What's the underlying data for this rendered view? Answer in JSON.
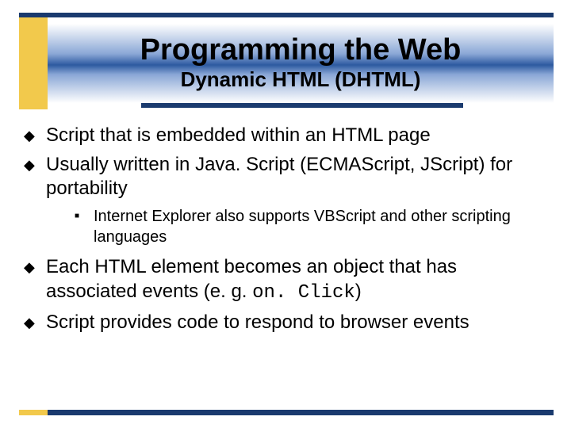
{
  "header": {
    "title": "Programming the Web",
    "subtitle": "Dynamic HTML (DHTML)"
  },
  "bullets": {
    "b1": "Script that is embedded within an HTML page",
    "b2": "Usually written in Java. Script (ECMAScript, JScript) for portability",
    "b2a": "Internet Explorer also supports VBScript and other scripting languages",
    "b3_pre": "Each HTML element becomes an object that has associated events (e. g. ",
    "b3_code": "on. Click",
    "b3_post": ")",
    "b4": "Script provides code to respond to browser events"
  }
}
